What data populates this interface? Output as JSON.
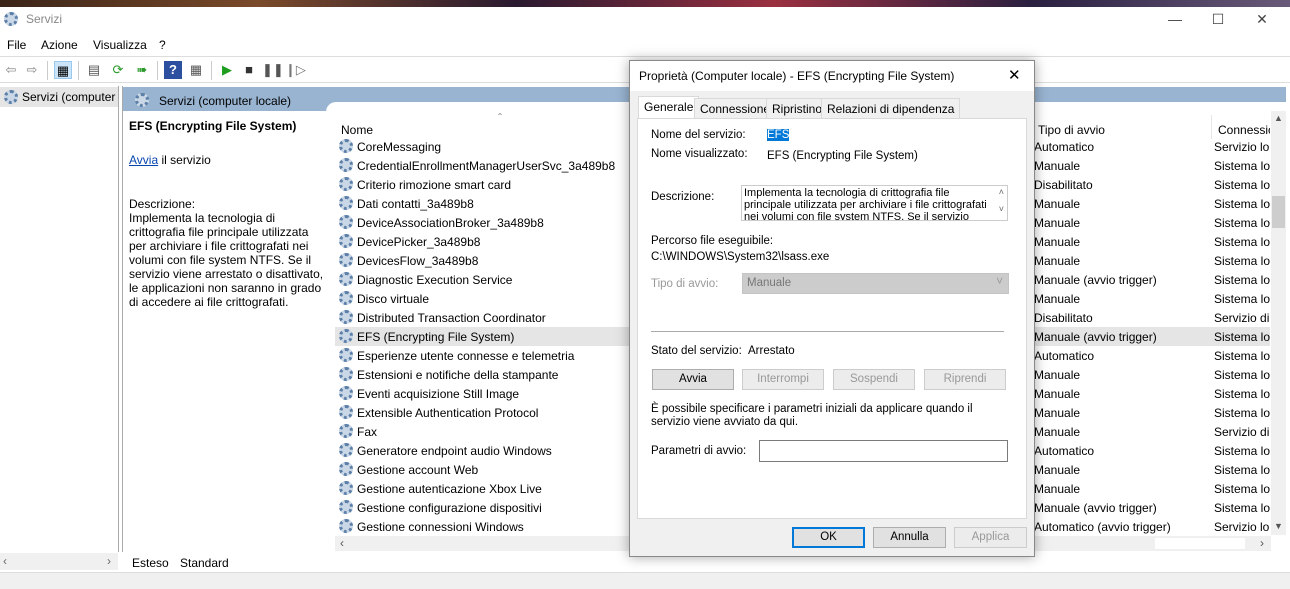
{
  "window": {
    "title": "Servizi"
  },
  "menu": [
    "File",
    "Azione",
    "Visualizza",
    "?"
  ],
  "tree": {
    "item": "Servizi (computer"
  },
  "band": {
    "title": "Servizi (computer locale)"
  },
  "detail": {
    "name": "EFS (Encrypting File System)",
    "link": "Avvia",
    "link_suffix": " il servizio",
    "desc_label": "Descrizione:",
    "desc": "Implementa la tecnologia di crittografia file principale utilizzata per archiviare i file crittografati nei volumi con file system NTFS. Se il servizio viene arrestato o disattivato, le applicazioni non saranno in grado di accedere ai file crittografati."
  },
  "columns": {
    "name": "Nome",
    "startup": "Tipo di avvio",
    "logon": "Connessic"
  },
  "rows": [
    {
      "name": "CoreMessaging",
      "startup": "Automatico",
      "logon": "Servizio lo"
    },
    {
      "name": "CredentialEnrollmentManagerUserSvc_3a489b8",
      "startup": "Manuale",
      "logon": "Sistema lo"
    },
    {
      "name": "Criterio rimozione smart card",
      "startup": "Disabilitato",
      "logon": "Sistema lo"
    },
    {
      "name": "Dati contatti_3a489b8",
      "startup": "Manuale",
      "logon": "Sistema lo"
    },
    {
      "name": "DeviceAssociationBroker_3a489b8",
      "startup": "Manuale",
      "logon": "Sistema lo"
    },
    {
      "name": "DevicePicker_3a489b8",
      "startup": "Manuale",
      "logon": "Sistema lo"
    },
    {
      "name": "DevicesFlow_3a489b8",
      "startup": "Manuale",
      "logon": "Sistema lo"
    },
    {
      "name": "Diagnostic Execution Service",
      "startup": "Manuale (avvio trigger)",
      "logon": "Sistema lo"
    },
    {
      "name": "Disco virtuale",
      "startup": "Manuale",
      "logon": "Sistema lo"
    },
    {
      "name": "Distributed Transaction Coordinator",
      "startup": "Disabilitato",
      "logon": "Servizio di"
    },
    {
      "name": "EFS (Encrypting File System)",
      "startup": "Manuale (avvio trigger)",
      "logon": "Sistema lo"
    },
    {
      "name": "Esperienze utente connesse e telemetria",
      "startup": "Automatico",
      "logon": "Sistema lo"
    },
    {
      "name": "Estensioni e notifiche della stampante",
      "startup": "Manuale",
      "logon": "Sistema lo"
    },
    {
      "name": "Eventi acquisizione Still Image",
      "startup": "Manuale",
      "logon": "Sistema lo"
    },
    {
      "name": "Extensible Authentication Protocol",
      "startup": "Manuale",
      "logon": "Sistema lo"
    },
    {
      "name": "Fax",
      "startup": "Manuale",
      "logon": "Servizio di"
    },
    {
      "name": "Generatore endpoint audio Windows",
      "startup": "Automatico",
      "logon": "Sistema lo"
    },
    {
      "name": "Gestione account Web",
      "startup": "Manuale",
      "logon": "Sistema lo"
    },
    {
      "name": "Gestione autenticazione Xbox Live",
      "startup": "Manuale",
      "logon": "Sistema lo"
    },
    {
      "name": "Gestione configurazione dispositivi",
      "startup": "Manuale (avvio trigger)",
      "logon": "Sistema lo"
    },
    {
      "name": "Gestione connessioni Windows",
      "startup": "Automatico (avvio trigger)",
      "logon": "Servizio lo"
    }
  ],
  "bottom_tabs": [
    "Esteso",
    "Standard"
  ],
  "dialog": {
    "title": "Proprietà (Computer locale) - EFS (Encrypting File System)",
    "tabs": [
      "Generale",
      "Connessione",
      "Ripristino",
      "Relazioni di dipendenza"
    ],
    "service_name_label": "Nome del servizio:",
    "service_name": "EFS",
    "display_name_label": "Nome visualizzato:",
    "display_name": "EFS (Encrypting File System)",
    "desc_label": "Descrizione:",
    "desc": "Implementa la tecnologia di crittografia file principale utilizzata per archiviare i file crittografati nei volumi con file system NTFS. Se il servizio viene arrestato o",
    "path_label": "Percorso file eseguibile:",
    "path": "C:\\WINDOWS\\System32\\lsass.exe",
    "startup_label": "Tipo di avvio:",
    "startup": "Manuale",
    "status_label": "Stato del servizio:",
    "status": "Arrestato",
    "buttons": {
      "start": "Avvia",
      "stop": "Interrompi",
      "pause": "Sospendi",
      "resume": "Riprendi"
    },
    "hint": "È possibile specificare i parametri iniziali da applicare quando il servizio viene avviato da qui.",
    "params_label": "Parametri di avvio:",
    "params_value": "",
    "ok": "OK",
    "cancel": "Annulla",
    "apply": "Applica"
  }
}
